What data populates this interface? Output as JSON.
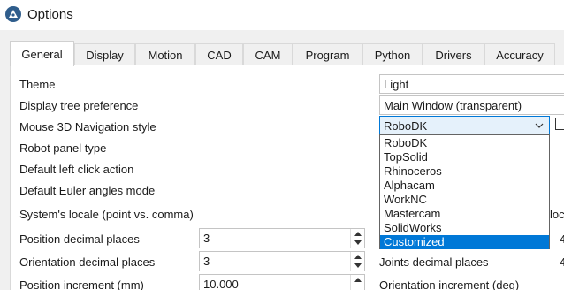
{
  "window": {
    "title": "Options",
    "app_icon": "robodk-logo-icon"
  },
  "tabs": [
    {
      "label": "General",
      "active": true
    },
    {
      "label": "Display",
      "active": false
    },
    {
      "label": "Motion",
      "active": false
    },
    {
      "label": "CAD",
      "active": false
    },
    {
      "label": "CAM",
      "active": false
    },
    {
      "label": "Program",
      "active": false
    },
    {
      "label": "Python",
      "active": false
    },
    {
      "label": "Drivers",
      "active": false
    },
    {
      "label": "Accuracy",
      "active": false
    }
  ],
  "general": {
    "theme": {
      "label": "Theme",
      "value": "Light"
    },
    "display_tree": {
      "label": "Display tree preference",
      "value": "Main Window (transparent)"
    },
    "navigation": {
      "label": "Mouse 3D Navigation style",
      "value": "RoboDK",
      "options": [
        "RoboDK",
        "TopSolid",
        "Rhinoceros",
        "Alphacam",
        "WorkNC",
        "Mastercam",
        "SolidWorks",
        "Customized"
      ],
      "highlighted": "Customized"
    },
    "robot_panel": {
      "label": "Robot panel type"
    },
    "left_click": {
      "label": "Default left click action"
    },
    "euler": {
      "label": "Default Euler angles mode"
    },
    "locale": {
      "label": "System's locale (point vs. comma)",
      "clipped_value": "loc"
    },
    "position_decimals": {
      "label": "Position decimal places",
      "value": "3",
      "clipped_right": "4"
    },
    "orientation_decimals": {
      "label": "Orientation decimal places",
      "value": "3",
      "clipped_right": "4"
    },
    "joints_decimals": {
      "label": "Joints decimal places"
    },
    "position_increment": {
      "label": "Position increment (mm)",
      "value": "10.000"
    },
    "orientation_increment": {
      "label": "Orientation increment (deg)"
    }
  },
  "colors": {
    "accent": "#0078d7",
    "panel_bg": "#ffffff",
    "window_bg": "#f0f0f0"
  }
}
